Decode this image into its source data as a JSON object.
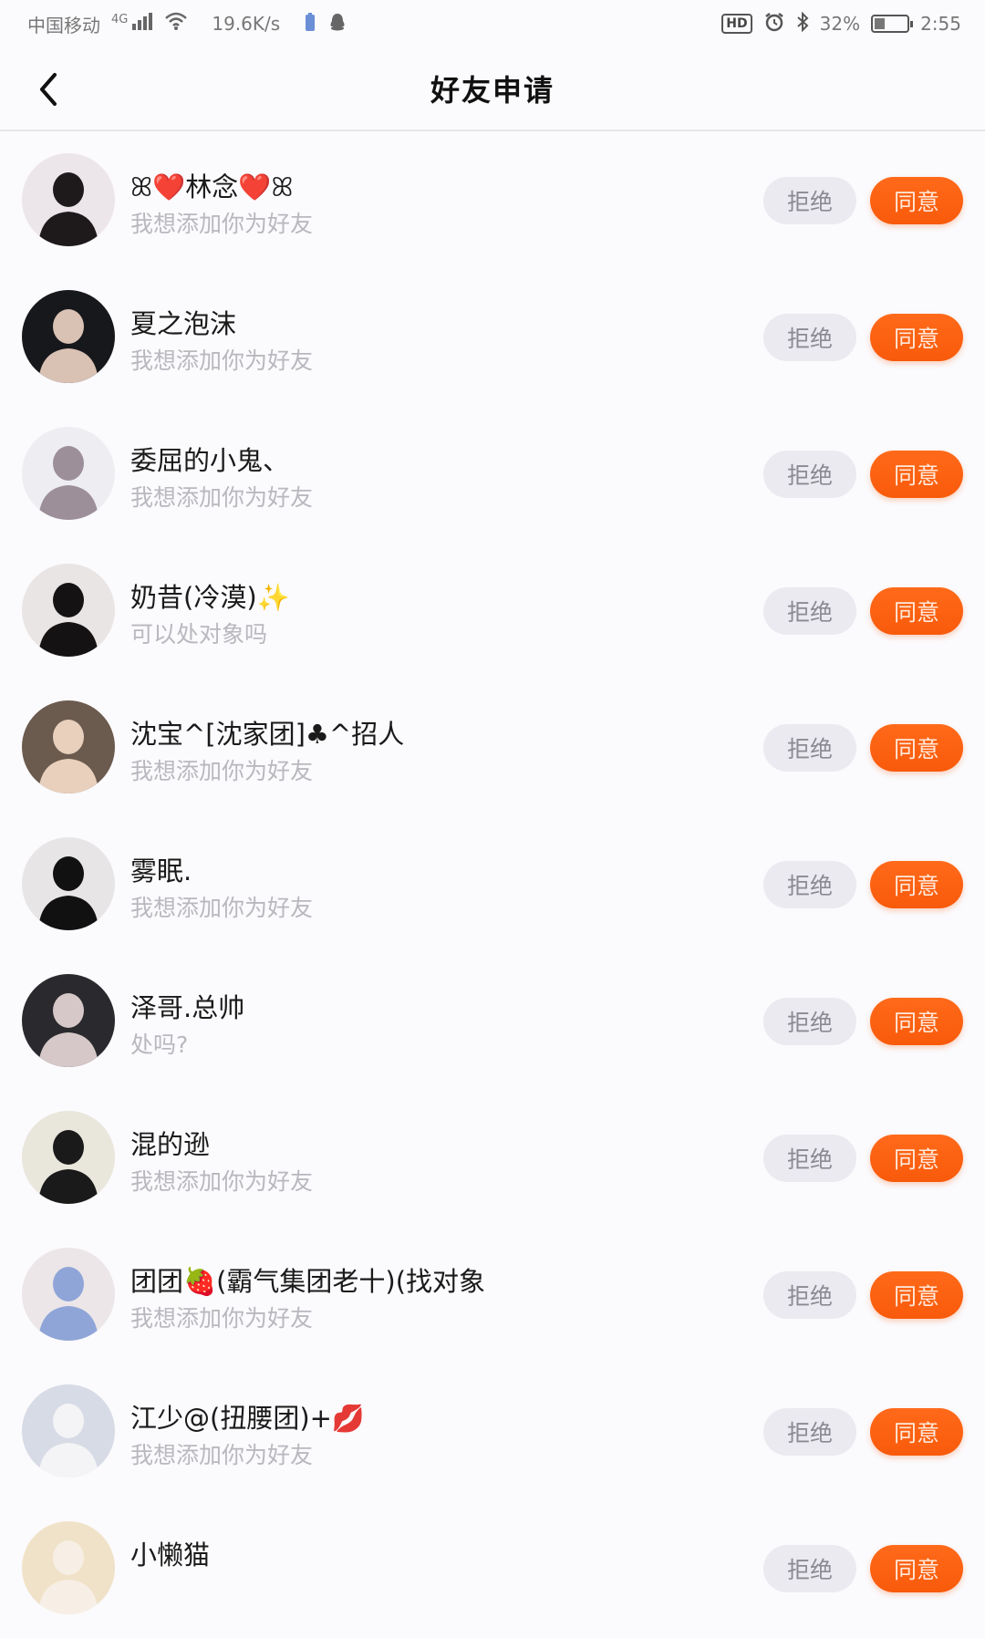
{
  "status_bar": {
    "carrier": "中国移动",
    "network": "4G",
    "speed": "19.6K/s",
    "hd": "HD",
    "battery": "32%",
    "battery_level": 0.32,
    "time": "2:55"
  },
  "header": {
    "title": "好友申请"
  },
  "colors": {
    "accent": "#fa5f10",
    "reject_bg": "#ebeaf0",
    "subtext": "#b9b8bf"
  },
  "requests": [
    {
      "name": "ꕤ❤️林念❤️ꕤ",
      "message": "我想添加你为好友",
      "reject": "拒绝",
      "accept": "同意",
      "avatar_colors": [
        "#ece6ea",
        "#1e1a1c"
      ]
    },
    {
      "name": "夏之泡沫",
      "message": "我想添加你为好友",
      "reject": "拒绝",
      "accept": "同意",
      "avatar_colors": [
        "#17181c",
        "#d9c1b4"
      ]
    },
    {
      "name": "委屈的小鬼、",
      "message": "我想添加你为好友",
      "reject": "拒绝",
      "accept": "同意",
      "avatar_colors": [
        "#eeeef2",
        "#9c8f9a"
      ]
    },
    {
      "name": "奶昔(冷漠)✨",
      "message": "可以处对象吗",
      "reject": "拒绝",
      "accept": "同意",
      "avatar_colors": [
        "#e9e5e4",
        "#141212"
      ]
    },
    {
      "name": "沈宝^[沈家团]♣^招人",
      "message": "我想添加你为好友",
      "reject": "拒绝",
      "accept": "同意",
      "avatar_colors": [
        "#6b5a4e",
        "#e8d0bc"
      ]
    },
    {
      "name": "雾眠.",
      "message": "我想添加你为好友",
      "reject": "拒绝",
      "accept": "同意",
      "avatar_colors": [
        "#e7e5e6",
        "#111111"
      ]
    },
    {
      "name": "泽哥.总帅",
      "message": "处吗?",
      "reject": "拒绝",
      "accept": "同意",
      "avatar_colors": [
        "#2a2a2e",
        "#d6c8c8"
      ]
    },
    {
      "name": "混的逊",
      "message": "我想添加你为好友",
      "reject": "拒绝",
      "accept": "同意",
      "avatar_colors": [
        "#e9e6dc",
        "#1a1a1a"
      ]
    },
    {
      "name": "团团🍓(霸气集团老十)(找对象",
      "message": "我想添加你为好友",
      "reject": "拒绝",
      "accept": "同意",
      "avatar_colors": [
        "#ece6e8",
        "#8fa5d8"
      ]
    },
    {
      "name": "江少@(扭腰团)+💋",
      "message": "我想添加你为好友",
      "reject": "拒绝",
      "accept": "同意",
      "avatar_colors": [
        "#d7dbe6",
        "#f4f4f6"
      ]
    },
    {
      "name": "小懒猫",
      "message": "",
      "reject": "拒绝",
      "accept": "同意",
      "avatar_colors": [
        "#f0e2c8",
        "#f7efe5"
      ]
    }
  ]
}
